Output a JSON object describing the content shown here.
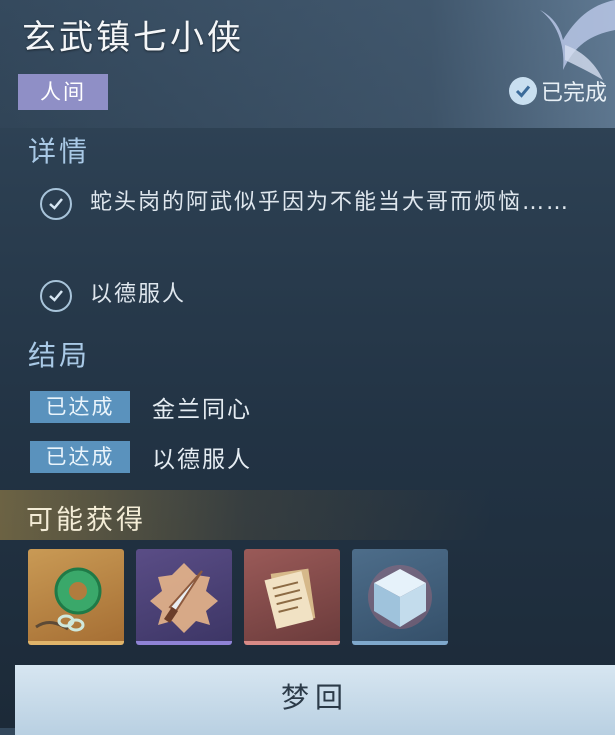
{
  "header": {
    "title": "玄武镇七小侠",
    "tag": "人间",
    "status": "已完成"
  },
  "details": {
    "title": "详情",
    "items": [
      {
        "text": "蛇头岗的阿武似乎因为不能当大哥而烦恼……"
      },
      {
        "text": "以德服人"
      }
    ]
  },
  "endings": {
    "title": "结局",
    "items": [
      {
        "badge": "已达成",
        "text": "金兰同心"
      },
      {
        "badge": "已达成",
        "text": "以德服人"
      }
    ]
  },
  "rewards": {
    "title": "可能获得",
    "items": [
      {
        "icon": "jade-pendant-icon",
        "rarity": "gold"
      },
      {
        "icon": "dagger-icon",
        "rarity": "purple"
      },
      {
        "icon": "paper-scroll-icon",
        "rarity": "red"
      },
      {
        "icon": "crystal-cube-icon",
        "rarity": "blue"
      }
    ]
  },
  "action": {
    "label": "梦回"
  },
  "colors": {
    "accent": "#a9c9e6",
    "tag": "#8f8fc6",
    "badge": "#5a92bd"
  }
}
